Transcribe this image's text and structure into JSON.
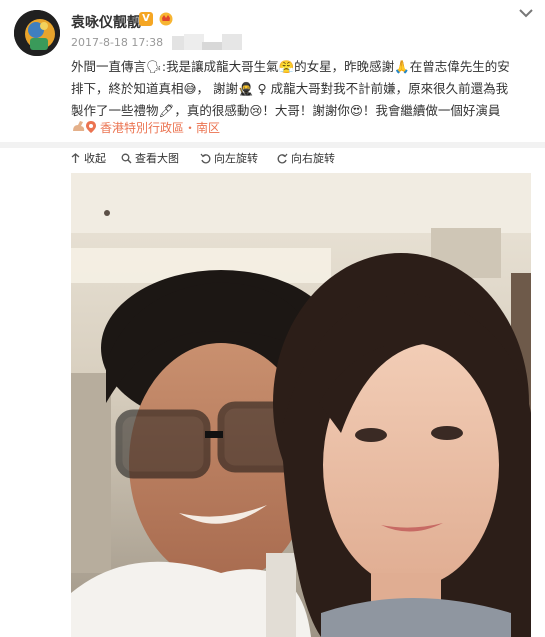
{
  "author": {
    "name": "袁咏仪靓靓",
    "verified_badge": "V"
  },
  "meta": {
    "time": "2017-8-18 17:38"
  },
  "post": {
    "lines": [
      "外間一直傳言🗣:我是讓成龍大哥生氣😤的女星，昨晚感謝🙏在曾志偉先生的安",
      "排下，終於知道真相😅， 謝謝🥷 ♀ 成龍大哥對我不計前嫌，原來很久前還為我",
      "製作了一些禮物🖊，真的很感動😢！大哥！謝謝你😍！我會繼續做一個好演員"
    ],
    "location": "香港特別行政區・南区"
  },
  "toolbar": {
    "collapse": "收起",
    "view_large": "查看大图",
    "rotate_left": "向左旋转",
    "rotate_right": "向右旋转"
  },
  "colors": {
    "accent": "#eb7350",
    "badge": "#f5a623",
    "muted": "#999999"
  },
  "icons": [
    "chevron-down-icon",
    "verified-icon",
    "crown-icon",
    "location-pin-icon",
    "collapse-icon",
    "zoom-icon",
    "rotate-left-icon",
    "rotate-right-icon"
  ]
}
